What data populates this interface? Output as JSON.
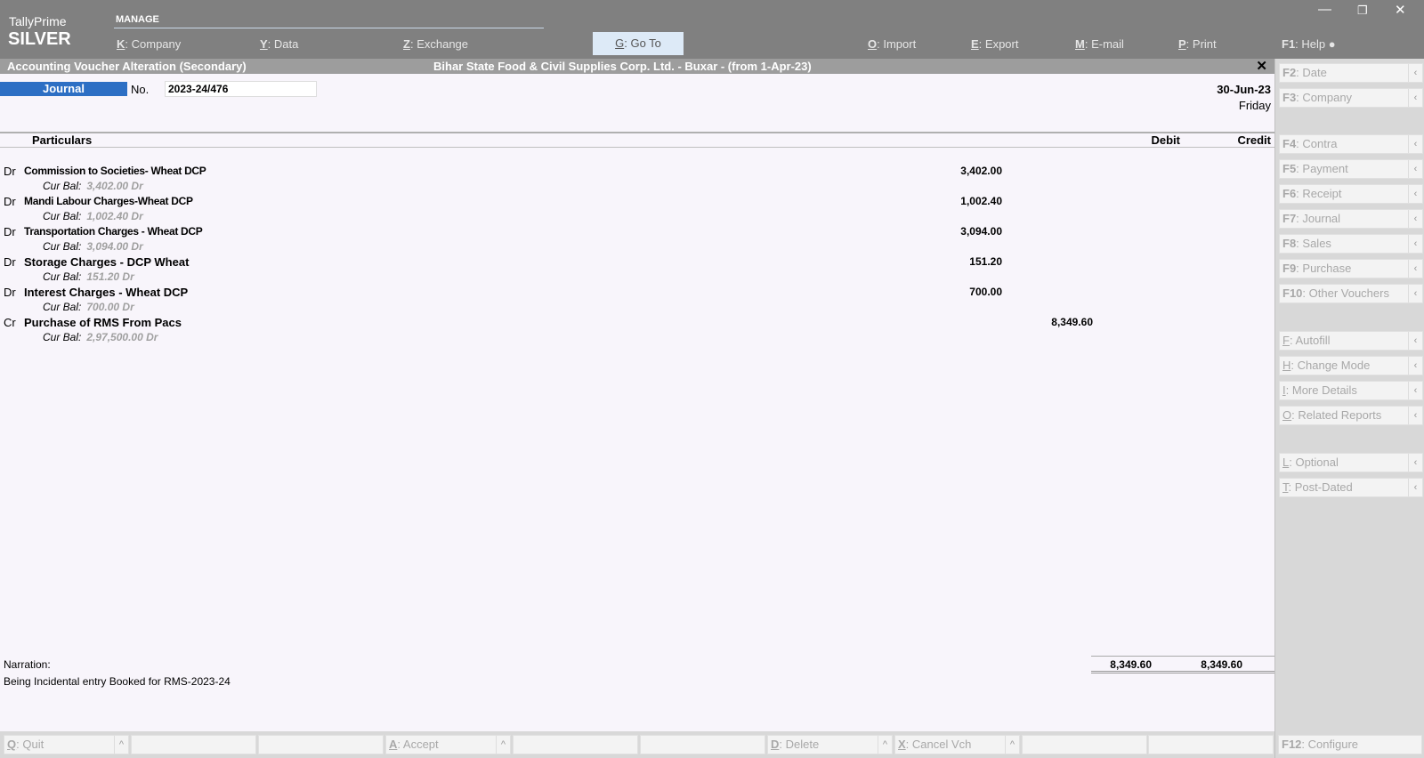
{
  "brand": {
    "product": "TallyPrime",
    "edition": "SILVER"
  },
  "top_menu": {
    "section": "MANAGE",
    "items": [
      {
        "key": "K",
        "label": "Company"
      },
      {
        "key": "Y",
        "label": "Data"
      },
      {
        "key": "Z",
        "label": "Exchange"
      },
      {
        "key": "G",
        "label": "Go To"
      },
      {
        "key": "O",
        "label": "Import"
      },
      {
        "key": "E",
        "label": "Export"
      },
      {
        "key": "M",
        "label": "E-mail"
      },
      {
        "key": "P",
        "label": "Print"
      },
      {
        "key": "F1",
        "label": "Help"
      }
    ]
  },
  "window_controls": {
    "minimize": "—",
    "restore": "❐",
    "close": "✕"
  },
  "titlebar": {
    "left": "Accounting Voucher Alteration (Secondary)",
    "center": "Bihar State Food & Civil Supplies Corp. Ltd. - Buxar - (from 1-Apr-23)",
    "close": "✕"
  },
  "voucher": {
    "type": "Journal",
    "no_label": "No.",
    "number": "2023-24/476",
    "date": "30-Jun-23",
    "day": "Friday"
  },
  "columns": {
    "particulars": "Particulars",
    "debit": "Debit",
    "credit": "Credit"
  },
  "entries": [
    {
      "drcr": "Dr",
      "ledger": "Commission to Societies- Wheat DCP",
      "debit": "3,402.00",
      "credit": "",
      "curbal_label": "Cur Bal:",
      "curbal": "3,402.00 Dr"
    },
    {
      "drcr": "Dr",
      "ledger": "Mandi Labour Charges-Wheat DCP",
      "debit": "1,002.40",
      "credit": "",
      "curbal_label": "Cur Bal:",
      "curbal": "1,002.40 Dr"
    },
    {
      "drcr": "Dr",
      "ledger": "Transportation Charges - Wheat DCP",
      "debit": "3,094.00",
      "credit": "",
      "curbal_label": "Cur Bal:",
      "curbal": "3,094.00 Dr"
    },
    {
      "drcr": "Dr",
      "ledger": "Storage Charges - DCP Wheat",
      "debit": "151.20",
      "credit": "",
      "curbal_label": "Cur Bal:",
      "curbal": "151.20 Dr"
    },
    {
      "drcr": "Dr",
      "ledger": "Interest Charges - Wheat DCP",
      "debit": "700.00",
      "credit": "",
      "curbal_label": "Cur Bal:",
      "curbal": "700.00 Dr"
    },
    {
      "drcr": "Cr",
      "ledger": "Purchase of RMS From Pacs",
      "debit": "",
      "credit": "8,349.60",
      "curbal_label": "Cur Bal:",
      "curbal": "2,97,500.00 Dr"
    }
  ],
  "narration": {
    "label": "Narration:",
    "text": "Being Incidental entry Booked for RMS-2023-24"
  },
  "totals": {
    "debit": "8,349.60",
    "credit": "8,349.60"
  },
  "right_panel": [
    {
      "key": "F2",
      "label": "Date"
    },
    {
      "key": "F3",
      "label": "Company"
    },
    {
      "key": "F4",
      "label": "Contra"
    },
    {
      "key": "F5",
      "label": "Payment"
    },
    {
      "key": "F6",
      "label": "Receipt"
    },
    {
      "key": "F7",
      "label": "Journal"
    },
    {
      "key": "F8",
      "label": "Sales"
    },
    {
      "key": "F9",
      "label": "Purchase"
    },
    {
      "key": "F10",
      "label": "Other Vouchers"
    },
    {
      "key": "F",
      "label": "Autofill"
    },
    {
      "key": "H",
      "label": "Change Mode"
    },
    {
      "key": "I",
      "label": "More Details"
    },
    {
      "key": "O",
      "label": "Related Reports"
    },
    {
      "key": "L",
      "label": "Optional"
    },
    {
      "key": "T",
      "label": "Post-Dated"
    }
  ],
  "bottom_bar": [
    {
      "key": "Q",
      "label": "Quit"
    },
    {
      "key": "A",
      "label": "Accept"
    },
    {
      "key": "D",
      "label": "Delete"
    },
    {
      "key": "X",
      "label": "Cancel Vch"
    }
  ],
  "configure": {
    "key": "F12",
    "label": "Configure"
  },
  "colors": {
    "topbar": "#808080",
    "titlebar": "#9d9d9d",
    "voucher_type_bg": "#2d6fc4",
    "content_bg": "#f8f5fb",
    "goto_bg": "#ddeaf7"
  }
}
